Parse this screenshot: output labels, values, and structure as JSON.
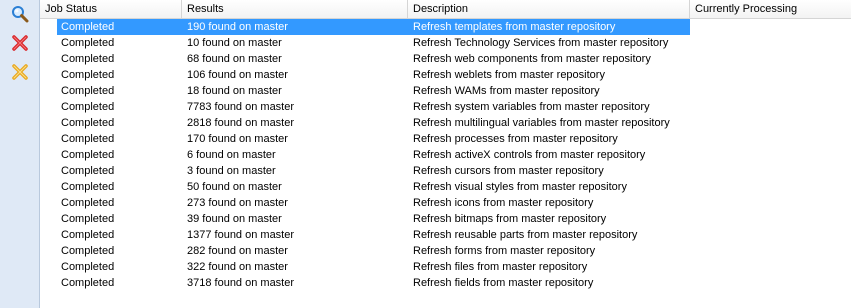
{
  "toolbar": {
    "buttons": [
      {
        "icon": "magnifier-icon",
        "color": "#2b7fd4"
      },
      {
        "icon": "delete-icon",
        "color": "#d8262a"
      },
      {
        "icon": "clear-icon",
        "color": "#e8a820"
      }
    ]
  },
  "grid": {
    "columns": [
      "Job Status",
      "Results",
      "Description",
      "Currently Processing"
    ],
    "selected_index": 0,
    "rows": [
      {
        "status": "Completed",
        "results": "190 found on master",
        "description": "Refresh templates from master repository",
        "processing": ""
      },
      {
        "status": "Completed",
        "results": "10 found on master",
        "description": "Refresh Technology Services from master repository",
        "processing": ""
      },
      {
        "status": "Completed",
        "results": "68 found on master",
        "description": "Refresh web components from master repository",
        "processing": ""
      },
      {
        "status": "Completed",
        "results": "106 found on master",
        "description": "Refresh weblets from master repository",
        "processing": ""
      },
      {
        "status": "Completed",
        "results": "18 found on master",
        "description": "Refresh WAMs from master repository",
        "processing": ""
      },
      {
        "status": "Completed",
        "results": "7783 found on master",
        "description": "Refresh system variables from master repository",
        "processing": ""
      },
      {
        "status": "Completed",
        "results": "2818 found on master",
        "description": "Refresh multilingual variables from master repository",
        "processing": ""
      },
      {
        "status": "Completed",
        "results": "170 found on master",
        "description": "Refresh processes from master repository",
        "processing": ""
      },
      {
        "status": "Completed",
        "results": "6 found on master",
        "description": "Refresh activeX controls from master repository",
        "processing": ""
      },
      {
        "status": "Completed",
        "results": "3 found on master",
        "description": "Refresh cursors from master repository",
        "processing": ""
      },
      {
        "status": "Completed",
        "results": "50 found on master",
        "description": "Refresh visual styles from master repository",
        "processing": ""
      },
      {
        "status": "Completed",
        "results": "273 found on master",
        "description": "Refresh icons from master repository",
        "processing": ""
      },
      {
        "status": "Completed",
        "results": "39 found on master",
        "description": "Refresh bitmaps from master repository",
        "processing": ""
      },
      {
        "status": "Completed",
        "results": "1377 found on master",
        "description": "Refresh reusable parts from master repository",
        "processing": ""
      },
      {
        "status": "Completed",
        "results": "282 found on master",
        "description": "Refresh forms from master repository",
        "processing": ""
      },
      {
        "status": "Completed",
        "results": "322 found on master",
        "description": "Refresh files from master repository",
        "processing": ""
      },
      {
        "status": "Completed",
        "results": "3718 found on master",
        "description": "Refresh fields from master repository",
        "processing": ""
      }
    ]
  },
  "colors": {
    "selection": "#3399ff",
    "toolbar_bg": "#dfe9f6"
  }
}
